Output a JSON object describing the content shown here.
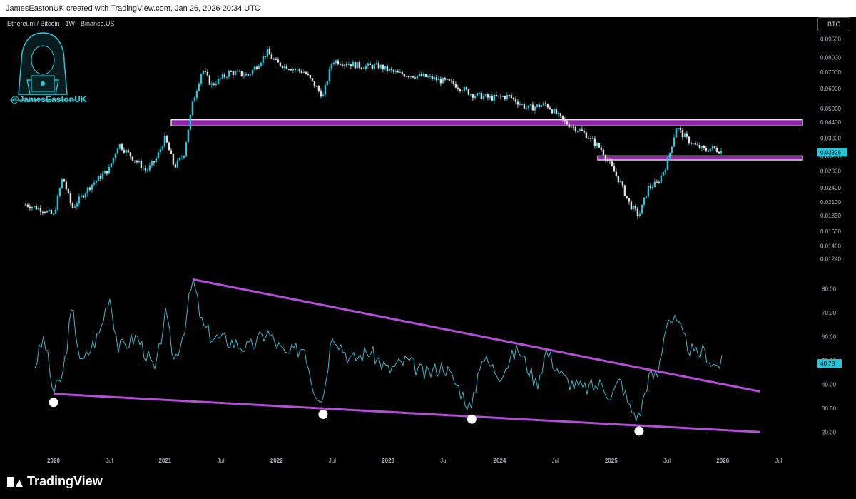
{
  "header": {
    "credit": "JamesEastonUK created with TradingView.com, Jan 26, 2026 20:34 UTC"
  },
  "symbol_label": "Ethereum / Bitcoin · 1W · Binance.US",
  "currency_button": "BTC",
  "watermark_handle": "@JamesEastonUK",
  "brand": "TradingView",
  "colors": {
    "up": "#26c6da",
    "down": "#e0e0e0",
    "zone": "#8e24aa",
    "rsi": "#3fb7c9",
    "trend": "#b24fd6"
  },
  "chart_data": [
    {
      "type": "candlestick",
      "title": "",
      "y_scale": "log",
      "ylim": [
        0.0112,
        0.098
      ],
      "y_ticks": [
        "0.09500",
        "0.08000",
        "0.07000",
        "0.06000",
        "0.05000",
        "0.04400",
        "0.03800",
        "0.03200",
        "0.02800",
        "0.02400",
        "0.02100",
        "0.01850",
        "0.01600",
        "0.01400",
        "0.01240"
      ],
      "last_price_label": "0.03326",
      "last_price": 0.03326,
      "close_series": {
        "x": [
          "2019-10",
          "2019-12",
          "2020-01",
          "2020-02",
          "2020-03",
          "2020-05",
          "2020-07",
          "2020-08",
          "2020-09",
          "2020-11",
          "2020-12",
          "2021-01",
          "2021-02",
          "2021-03",
          "2021-04",
          "2021-05",
          "2021-06",
          "2021-08",
          "2021-10",
          "2021-12",
          "2022-01",
          "2022-04",
          "2022-06",
          "2022-07",
          "2022-10",
          "2022-12",
          "2023-02",
          "2023-05",
          "2023-08",
          "2023-10",
          "2023-12",
          "2024-02",
          "2024-04",
          "2024-06",
          "2024-08",
          "2024-10",
          "2024-12",
          "2025-02",
          "2025-03",
          "2025-04",
          "2025-05",
          "2025-06",
          "2025-07",
          "2025-08",
          "2025-09",
          "2025-10",
          "2025-11",
          "2025-12",
          "2026-01"
        ],
        "values": [
          0.0205,
          0.0195,
          0.0185,
          0.0265,
          0.0198,
          0.0245,
          0.0285,
          0.036,
          0.033,
          0.028,
          0.031,
          0.038,
          0.029,
          0.0325,
          0.053,
          0.072,
          0.062,
          0.07,
          0.068,
          0.084,
          0.076,
          0.07,
          0.056,
          0.078,
          0.074,
          0.074,
          0.069,
          0.067,
          0.063,
          0.057,
          0.055,
          0.056,
          0.05,
          0.052,
          0.044,
          0.04,
          0.034,
          0.025,
          0.0205,
          0.0185,
          0.024,
          0.025,
          0.03,
          0.042,
          0.038,
          0.0355,
          0.034,
          0.0345,
          0.0333
        ]
      },
      "zones": [
        {
          "from": 0.0425,
          "to": 0.045
        },
        {
          "from": 0.031,
          "to": 0.0322
        }
      ]
    },
    {
      "type": "line",
      "title": "",
      "ylim": [
        15,
        85
      ],
      "y_ticks": [
        "80.00",
        "70.00",
        "60.00",
        "50.00",
        "40.00",
        "30.00",
        "20.00"
      ],
      "last_value_label": "48.78",
      "series": [
        {
          "x": [
            "2019-11",
            "2019-12",
            "2020-01",
            "2020-02",
            "2020-03",
            "2020-04",
            "2020-06",
            "2020-07",
            "2020-08",
            "2020-10",
            "2020-12",
            "2021-01",
            "2021-02",
            "2021-03",
            "2021-04",
            "2021-05",
            "2021-06",
            "2021-08",
            "2021-10",
            "2021-12",
            "2022-02",
            "2022-04",
            "2022-05",
            "2022-06",
            "2022-07",
            "2022-09",
            "2022-11",
            "2023-01",
            "2023-03",
            "2023-05",
            "2023-07",
            "2023-09",
            "2023-10",
            "2023-11",
            "2024-01",
            "2024-03",
            "2024-05",
            "2024-06",
            "2024-08",
            "2024-10",
            "2024-12",
            "2025-01",
            "2025-02",
            "2025-03",
            "2025-04",
            "2025-05",
            "2025-06",
            "2025-07",
            "2025-08",
            "2025-09",
            "2025-10",
            "2025-11",
            "2025-12",
            "2026-01"
          ],
          "values": [
            48,
            60,
            36,
            44,
            72,
            48,
            62,
            78,
            55,
            60,
            45,
            70,
            50,
            62,
            84,
            65,
            60,
            58,
            55,
            62,
            52,
            56,
            38,
            34,
            62,
            50,
            54,
            46,
            50,
            44,
            48,
            36,
            29,
            52,
            44,
            55,
            40,
            54,
            42,
            38,
            40,
            35,
            42,
            30,
            26,
            43,
            44,
            68,
            66,
            58,
            52,
            54,
            48,
            49
          ]
        }
      ],
      "trendlines": [
        {
          "from": {
            "x": "2021-04",
            "y": 84
          },
          "to": {
            "x": "2026-05",
            "y": 37
          }
        },
        {
          "from": {
            "x": "2020-01",
            "y": 36
          },
          "to": {
            "x": "2026-05",
            "y": 20
          }
        }
      ],
      "marked_lows": [
        {
          "x": "2020-01",
          "y": 36
        },
        {
          "x": "2022-06",
          "y": 31
        },
        {
          "x": "2023-10",
          "y": 29
        },
        {
          "x": "2025-04",
          "y": 24
        }
      ]
    }
  ],
  "x_axis_labels": [
    "2020",
    "Jul",
    "2021",
    "Jul",
    "2022",
    "Jul",
    "2023",
    "Jul",
    "2024",
    "Jul",
    "2025",
    "Jul",
    "2026",
    "Jul"
  ],
  "x_axis_label_dates": [
    "2020-01",
    "2020-07",
    "2021-01",
    "2021-07",
    "2022-01",
    "2022-07",
    "2023-01",
    "2023-07",
    "2024-01",
    "2024-07",
    "2025-01",
    "2025-07",
    "2026-01",
    "2026-07"
  ]
}
